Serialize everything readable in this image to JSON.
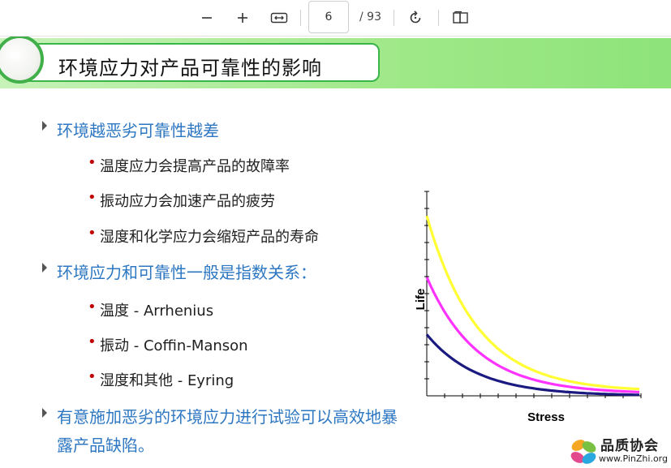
{
  "toolbar": {
    "zoom_out_icon": "minus-icon",
    "zoom_in_icon": "plus-icon",
    "fit_width_icon": "fit-width-icon",
    "page_number": "6",
    "page_total": "/ 93",
    "rotate_icon": "rotate-icon",
    "two_page_icon": "two-page-icon"
  },
  "slide": {
    "title": "环境应力对产品可靠性的影响",
    "bullets": [
      {
        "text": "环境越恶劣可靠性越差",
        "children": [
          "温度应力会提高产品的故障率",
          "振动应力会加速产品的疲劳",
          "湿度和化学应力会缩短产品的寿命"
        ]
      },
      {
        "text": "环境应力和可靠性一般是指数关系：",
        "children": [
          "温度 -  Arrhenius",
          "振动 -  Coffin-Manson",
          "湿度和其他 -  Eyring"
        ]
      },
      {
        "text": "有意施加恶劣的环境应力进行试验可以高效地暴",
        "text2": "露产品缺陷。",
        "children": []
      }
    ]
  },
  "chart_data": {
    "type": "line",
    "xlabel": "Stress",
    "ylabel": "Life",
    "series": [
      {
        "color": "#ffff33",
        "start": 0.88,
        "end": 0.02
      },
      {
        "color": "#ff33ff",
        "start": 0.58,
        "end": 0.01
      },
      {
        "color": "#1a1a80",
        "start": 0.3,
        "end": 0.0
      }
    ]
  },
  "watermark": {
    "name": "品质协会",
    "url": "www.PinZhi.org"
  },
  "colors": {
    "accent_green": "#39b54a",
    "bullet_blue": "#2d77c2",
    "bullet_red": "#c00000"
  }
}
